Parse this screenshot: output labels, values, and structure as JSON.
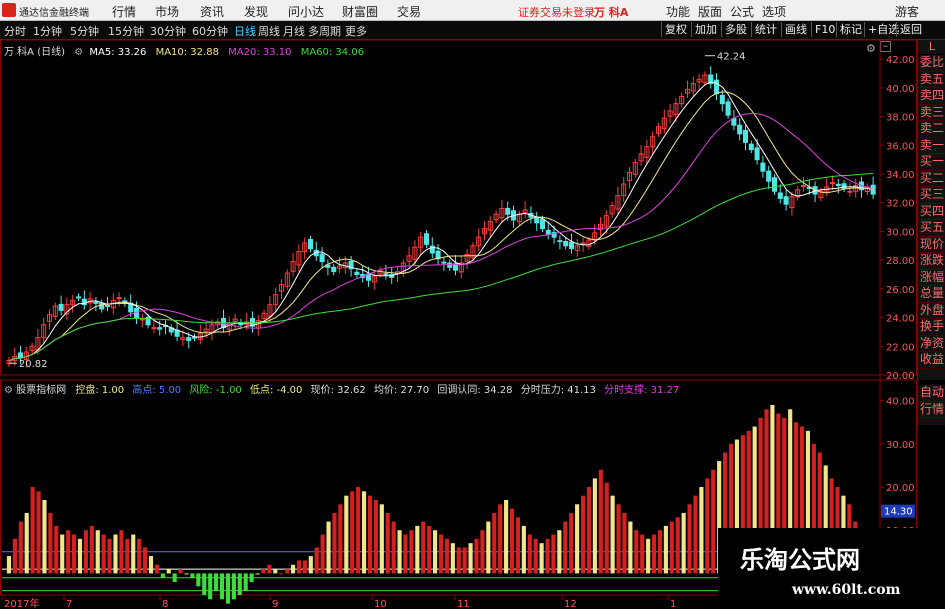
{
  "menubar": {
    "app_name": "通达信金融终端",
    "items": [
      "行情",
      "市场",
      "资讯",
      "发现",
      "问小达",
      "财富圈",
      "交易"
    ],
    "status": "证券交易未登录",
    "stock": "万 科A",
    "right_items": [
      "功能",
      "版面",
      "公式",
      "选项",
      "游客"
    ]
  },
  "toolbar": {
    "periods": [
      "分时",
      "1分钟",
      "5分钟",
      "15分钟",
      "30分钟",
      "60分钟",
      "日线",
      "周线",
      "月线",
      "多周期",
      "更多"
    ],
    "active_period": "日线",
    "right_buttons": [
      "复权",
      "加加",
      "多股",
      "统计",
      "画线",
      "F10",
      "标记",
      "+自选",
      "返回"
    ]
  },
  "main_legend": {
    "title": "万 科A (日线)",
    "ma": [
      {
        "label": "MA5: 33.26",
        "color": "#ffffff"
      },
      {
        "label": "MA10: 32.88",
        "color": "#f0e68c"
      },
      {
        "label": "MA20: 33.10",
        "color": "#e040e0"
      },
      {
        "label": "MA60: 34.06",
        "color": "#3cdc3c"
      }
    ]
  },
  "price_axis": [
    "42.00",
    "40.00",
    "38.00",
    "36.00",
    "34.00",
    "32.00",
    "30.00",
    "28.00",
    "26.00",
    "24.00",
    "22.00",
    "20.00"
  ],
  "annotations": {
    "high": "42.24",
    "low": "20.82"
  },
  "side_panel": [
    "委比",
    "卖五",
    "卖四",
    "卖三",
    "卖二",
    "卖一",
    "买一",
    "买二",
    "买三",
    "买四",
    "买五",
    "现价",
    "涨跌",
    "涨幅",
    "总量",
    "外盘",
    "换手",
    "净资",
    "收益"
  ],
  "side_panel2": [
    "自动",
    "行情"
  ],
  "side_corner": "L",
  "indicator_legend": {
    "name": "股票指标网",
    "items": [
      {
        "label": "控盘: 1.00",
        "color": "#f0e68c"
      },
      {
        "label": "高点: 5.00",
        "color": "#4f7cff"
      },
      {
        "label": "风险: -1.00",
        "color": "#3cdc3c"
      },
      {
        "label": "低点: -4.00",
        "color": "#f0e68c"
      },
      {
        "label": "现价: 32.62",
        "color": "#dddddd"
      },
      {
        "label": "均价: 27.70",
        "color": "#dddddd"
      },
      {
        "label": "回调认同: 34.28",
        "color": "#dddddd"
      },
      {
        "label": "分时压力: 41.13",
        "color": "#dddddd"
      },
      {
        "label": "分时支撑: 31.27",
        "color": "#e040e0"
      }
    ]
  },
  "indicator_axis": [
    "40.00",
    "30.00",
    "20.00",
    "10.00"
  ],
  "indicator_value_box": "14.30",
  "date_axis": [
    "2017年",
    "7",
    "8",
    "9",
    "10",
    "11",
    "12",
    "1"
  ],
  "watermark": {
    "line1": "乐淘公式网",
    "line2": "www.60lt.com"
  },
  "colors": {
    "up": "#ff3b3b",
    "down": "#50e6e6",
    "ma5": "#ffffff",
    "ma10": "#f0e68c",
    "ma20": "#e040e0",
    "ma60": "#3cdc3c"
  },
  "chart_data": [
    {
      "type": "candlestick",
      "title": "万 科A (日线)",
      "ylim": [
        20.0,
        42.5
      ],
      "x": [
        "2017年",
        "7",
        "8",
        "9",
        "10",
        "11",
        "12",
        "1"
      ],
      "closes": [
        21.0,
        21.3,
        21.2,
        21.6,
        22.0,
        22.6,
        23.5,
        24.2,
        24.8,
        24.5,
        24.9,
        25.2,
        25.4,
        24.9,
        25.3,
        25.0,
        24.6,
        24.8,
        25.2,
        25.4,
        25.0,
        24.4,
        24.0,
        23.9,
        23.5,
        23.3,
        23.2,
        23.4,
        23.0,
        22.7,
        22.6,
        22.4,
        22.6,
        22.9,
        23.2,
        23.5,
        23.7,
        23.3,
        23.6,
        23.9,
        23.5,
        23.7,
        23.4,
        23.8,
        24.3,
        24.9,
        25.6,
        26.3,
        27.1,
        27.9,
        28.6,
        29.2,
        28.8,
        28.3,
        27.9,
        27.5,
        27.2,
        27.6,
        27.8,
        27.4,
        27.0,
        26.8,
        26.6,
        26.9,
        27.3,
        27.0,
        26.8,
        27.2,
        27.8,
        28.3,
        28.9,
        29.6,
        29.1,
        28.5,
        28.1,
        27.8,
        27.5,
        27.3,
        27.8,
        28.4,
        29.0,
        29.6,
        30.2,
        30.7,
        31.2,
        31.6,
        31.2,
        30.8,
        31.2,
        31.5,
        31.0,
        30.6,
        30.2,
        29.8,
        29.6,
        29.3,
        29.0,
        28.8,
        29.0,
        29.2,
        29.4,
        29.9,
        30.5,
        31.1,
        31.8,
        32.5,
        33.3,
        34.1,
        34.8,
        35.4,
        35.9,
        36.6,
        37.3,
        37.9,
        38.4,
        38.9,
        39.4,
        39.9,
        40.3,
        40.6,
        40.9,
        40.3,
        39.6,
        38.9,
        38.1,
        37.4,
        36.8,
        36.2,
        35.7,
        35.0,
        34.2,
        33.5,
        32.8,
        32.3,
        31.9,
        32.4,
        32.9,
        33.2,
        33.0,
        32.6,
        32.8,
        33.1,
        33.4,
        33.2,
        33.0,
        32.8,
        33.2,
        32.9,
        33.1,
        32.6
      ],
      "ma_labels": [
        "MA5: 33.26",
        "MA10: 32.88",
        "MA20: 33.10",
        "MA60: 34.06"
      ]
    },
    {
      "type": "bar",
      "title": "股票指标网",
      "ylim": [
        -5,
        42
      ],
      "reference_lines": [
        5.0,
        1.0,
        -1.0,
        -4.0
      ],
      "values": [
        4,
        8,
        12,
        14,
        20,
        19,
        17,
        14,
        11,
        9,
        10,
        9,
        8,
        10,
        11,
        10,
        9,
        8,
        9,
        10,
        8,
        9,
        8,
        6,
        4,
        2,
        -1,
        1,
        -2,
        1,
        0,
        -1,
        -3,
        -5,
        -6,
        -4,
        -6,
        -7,
        -6,
        -5,
        -4,
        -2,
        0,
        1,
        2,
        1,
        0,
        1,
        2,
        3,
        3,
        4,
        6,
        9,
        12,
        14,
        16,
        18,
        19,
        20,
        19,
        18,
        17,
        16,
        14,
        12,
        10,
        9,
        10,
        11,
        12,
        11,
        10,
        9,
        8,
        7,
        6,
        6,
        7,
        8,
        10,
        12,
        14,
        16,
        17,
        15,
        13,
        11,
        9,
        8,
        7,
        8,
        9,
        10,
        12,
        14,
        16,
        18,
        20,
        22,
        24,
        21,
        18,
        16,
        14,
        12,
        10,
        9,
        8,
        9,
        10,
        11,
        12,
        13,
        14,
        16,
        18,
        20,
        22,
        24,
        26,
        28,
        30,
        31,
        32,
        33,
        34,
        36,
        38,
        39,
        37,
        36,
        38,
        35,
        34,
        33,
        30,
        28,
        25,
        22,
        20,
        18,
        16,
        12,
        10,
        8,
        6
      ]
    }
  ]
}
